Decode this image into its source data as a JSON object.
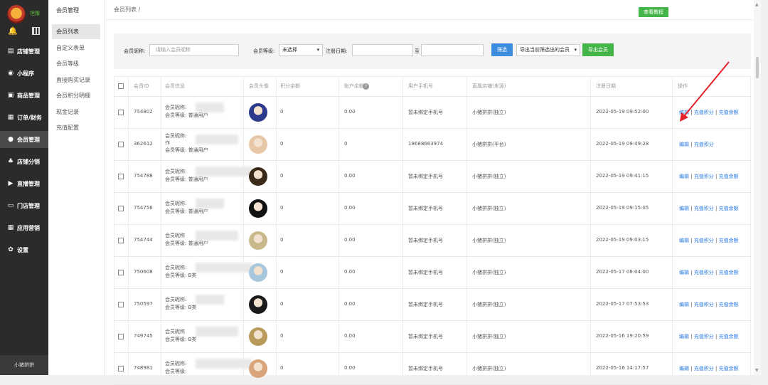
{
  "sidebar": {
    "shop_name": "坦豫",
    "footer": "小猪拼拼",
    "items": [
      {
        "label": "店铺管理",
        "icon": "store-icon"
      },
      {
        "label": "小程序",
        "icon": "miniprogram-icon"
      },
      {
        "label": "商品管理",
        "icon": "goods-icon"
      },
      {
        "label": "订单/财务",
        "icon": "order-icon"
      },
      {
        "label": "会员管理",
        "icon": "member-icon"
      },
      {
        "label": "店铺分销",
        "icon": "distribution-icon"
      },
      {
        "label": "直播管理",
        "icon": "live-icon"
      },
      {
        "label": "门店管理",
        "icon": "shop-icon"
      },
      {
        "label": "应用营销",
        "icon": "apps-icon"
      },
      {
        "label": "设置",
        "icon": "gear-icon"
      }
    ]
  },
  "submenu": {
    "title": "会员管理",
    "items": [
      "会员列表",
      "自定义表单",
      "会员等级",
      "直接购买记录",
      "会员积分明细",
      "现金记录",
      "充值配置"
    ]
  },
  "header": {
    "breadcrumb": "会员列表 /",
    "tutorial": "查看教程"
  },
  "filter": {
    "nickname_label": "会员昵称:",
    "nickname_placeholder": "请输入会员昵称",
    "level_label": "会员等级:",
    "level_value": "未选择",
    "date_label": "注册日期:",
    "date_to": "至",
    "filter_btn": "筛选",
    "export_select": "导出当前筛选出的会员",
    "export_btn": "导出会员"
  },
  "table": {
    "headers": [
      "会员ID",
      "会员信息",
      "会员头像",
      "积分余额",
      "账户余额",
      "用户手机号",
      "直属店铺(来源)",
      "注册日期",
      "操作"
    ],
    "actions": [
      "编辑",
      "充值积分",
      "充值余额"
    ],
    "rows": [
      {
        "id": "754802",
        "info1": "会员昵称:",
        "info2": "",
        "info3": "会员等级: 普通用户",
        "points": "0",
        "balance": "0.00",
        "phone": "暂未绑定手机号",
        "store": "小猪拼拼(独立)",
        "date": "2022-05-19 09:52:00",
        "actions": 3,
        "avatar": "#2b3a8a"
      },
      {
        "id": "362612",
        "info1": "会员昵称:",
        "info2": "作",
        "info3": "会员等级: 普通用户",
        "points": "0",
        "balance": "0",
        "phone": "18688663974",
        "store": "小猪拼拼(平台)",
        "date": "2022-05-19 09:49:28",
        "actions": 2,
        "avatar": "#e8c7a8"
      },
      {
        "id": "754788",
        "info1": "会员昵称:",
        "info2": "",
        "info3": "会员等级: 普通用户",
        "points": "0",
        "balance": "0.00",
        "phone": "暂未绑定手机号",
        "store": "小猪拼拼(独立)",
        "date": "2022-05-19 09:41:15",
        "actions": 3,
        "avatar": "#3a2a1a"
      },
      {
        "id": "754756",
        "info1": "会员昵称:",
        "info2": "",
        "info3": "会员等级: 普通用户",
        "points": "0",
        "balance": "0.00",
        "phone": "暂未绑定手机号",
        "store": "小猪拼拼(独立)",
        "date": "2022-05-19 09:15:05",
        "actions": 3,
        "avatar": "#111111"
      },
      {
        "id": "754744",
        "info1": "会员昵称",
        "info2": "",
        "info3": "会员等级: 普通用户",
        "points": "0",
        "balance": "0.00",
        "phone": "暂未绑定手机号",
        "store": "小猪拼拼(独立)",
        "date": "2022-05-19 09:03:15",
        "actions": 3,
        "avatar": "#c9b98a"
      },
      {
        "id": "750608",
        "info1": "会员昵称:",
        "info2": "",
        "info3": "会员等级: B类",
        "points": "0",
        "balance": "0.00",
        "phone": "暂未绑定手机号",
        "store": "小猪拼拼(独立)",
        "date": "2022-05-17 08:04:00",
        "actions": 3,
        "avatar": "#a9c7dc"
      },
      {
        "id": "750597",
        "info1": "会员昵称:",
        "info2": "",
        "info3": "会员等级: B类",
        "points": "0",
        "balance": "0.00",
        "phone": "暂未绑定手机号",
        "store": "小猪拼拼(独立)",
        "date": "2022-05-17 07:53:53",
        "actions": 3,
        "avatar": "#1a1a1a"
      },
      {
        "id": "749745",
        "info1": "会员昵称",
        "info2": "",
        "info3": "会员等级: B类",
        "points": "0",
        "balance": "0.00",
        "phone": "暂未绑定手机号",
        "store": "小猪拼拼(独立)",
        "date": "2022-05-16 19:20:59",
        "actions": 3,
        "avatar": "#b99a5a"
      },
      {
        "id": "748981",
        "info1": "会员昵称:",
        "info2": "",
        "info3": "会员等级:",
        "points": "0",
        "balance": "0.00",
        "phone": "暂未绑定手机号",
        "store": "小猪拼拼(独立)",
        "date": "2022-05-16 14:17:57",
        "actions": 3,
        "avatar": "#d9a47a"
      }
    ]
  },
  "colors": {
    "primary": "#44b549",
    "link": "#2a7ae2",
    "filter_blue": "#3c8dde",
    "arrow": "#e3222a"
  }
}
